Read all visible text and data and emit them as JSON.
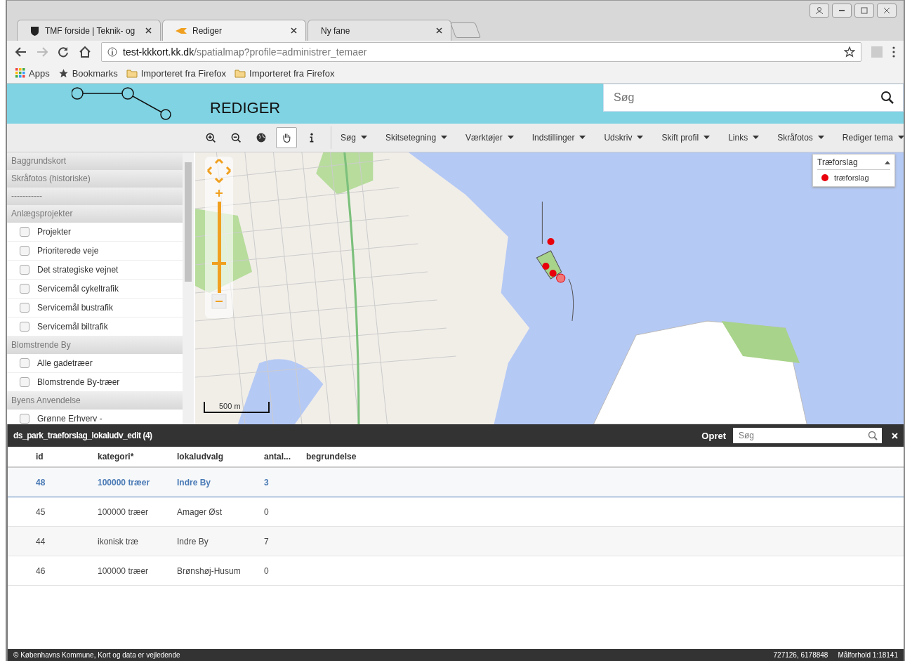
{
  "browser": {
    "tabs": [
      {
        "title": "TMF forside | Teknik- og",
        "selected": false
      },
      {
        "title": "Rediger",
        "selected": true
      },
      {
        "title": "Ny fane",
        "selected": false
      }
    ],
    "url": {
      "host": "test-kkkort.kk.dk",
      "path": "/spatialmap?profile=administrer_temaer"
    },
    "bookmarks": [
      {
        "label": "Apps",
        "kind": "apps"
      },
      {
        "label": "Bookmarks",
        "kind": "star"
      },
      {
        "label": "Importeret fra Firefox",
        "kind": "folder"
      },
      {
        "label": "Importeret fra Firefox",
        "kind": "folder"
      }
    ]
  },
  "header": {
    "title": "REDIGER",
    "search_placeholder": "Søg"
  },
  "toolbar": {
    "tools": [
      {
        "kind": "zoom-in",
        "selected": false
      },
      {
        "kind": "zoom-out",
        "selected": false
      },
      {
        "kind": "globe",
        "selected": false
      },
      {
        "kind": "hand",
        "selected": true
      },
      {
        "kind": "info",
        "selected": false
      }
    ],
    "menus": [
      "Søg",
      "Skitsetegning",
      "Værktøjer",
      "Indstillinger",
      "Udskriv",
      "Skift profil",
      "Links",
      "Skråfotos",
      "Rediger tema"
    ]
  },
  "sidebar": {
    "groups": [
      {
        "title": "Baggrundskort"
      },
      {
        "title": "Skråfotos (historiske)"
      },
      {
        "title": "-----------"
      },
      {
        "title": "Anlægsprojekter",
        "items": [
          {
            "label": "Projekter",
            "checked": false
          },
          {
            "label": "Prioriterede veje",
            "checked": false
          },
          {
            "label": "Det strategiske vejnet",
            "checked": false
          },
          {
            "label": "Servicemål cykeltrafik",
            "checked": false
          },
          {
            "label": "Servicemål bustrafik",
            "checked": false
          },
          {
            "label": "Servicemål biltrafik",
            "checked": false
          }
        ]
      },
      {
        "title": "Blomstrende By",
        "items": [
          {
            "label": "Alle gadetræer",
            "checked": false
          },
          {
            "label": "Blomstrende By-træer",
            "checked": false
          }
        ]
      },
      {
        "title": "Byens Anvendelse",
        "items": [
          {
            "label": "Grønne Erhverv -",
            "checked": false
          }
        ]
      }
    ]
  },
  "map": {
    "legend": {
      "title": "Træforslag",
      "items": [
        {
          "label": "træforslag",
          "color": "#e8000b"
        }
      ]
    },
    "scale": "500 m"
  },
  "table": {
    "title": "ds_park_traeforslag_lokaludv_edit (4)",
    "create": "Opret",
    "search_placeholder": "Søg",
    "columns": [
      "id",
      "kategori*",
      "lokaludvalg",
      "antal...",
      "begrundelse"
    ],
    "rows": [
      {
        "cells": [
          "48",
          "100000 træer",
          "Indre By",
          "3",
          ""
        ],
        "selected": true
      },
      {
        "cells": [
          "45",
          "100000 træer",
          "Amager Øst",
          "0",
          ""
        ],
        "selected": false
      },
      {
        "cells": [
          "44",
          "ikonisk træ",
          "Indre By",
          "7",
          ""
        ],
        "selected": false
      },
      {
        "cells": [
          "46",
          "100000 træer",
          "Brønshøj-Husum",
          "0",
          ""
        ],
        "selected": false
      }
    ]
  },
  "footer": {
    "copyright": "© Københavns Kommune, Kort og data er vejledende",
    "coordinates": "727126, 6178848",
    "scale": "Målforhold 1:18141"
  }
}
